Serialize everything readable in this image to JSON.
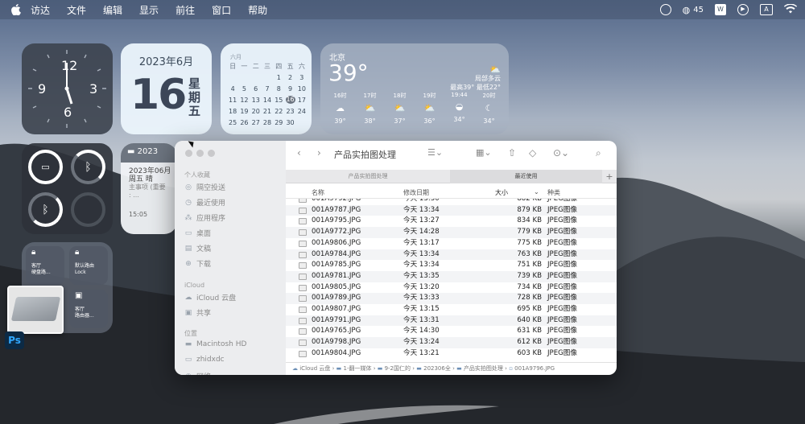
{
  "menubar": {
    "items": [
      "访达",
      "文件",
      "编辑",
      "显示",
      "前往",
      "窗口",
      "帮助"
    ],
    "wechat_count": "45"
  },
  "date_widget": {
    "year_month": "2023年6月",
    "day": "16",
    "weekday": "星期五"
  },
  "calendar_widget": {
    "month_label": "六月",
    "headers": [
      "日",
      "一",
      "二",
      "三",
      "四",
      "五",
      "六"
    ],
    "cells": [
      "",
      "",
      "",
      "",
      "1",
      "2",
      "3",
      "4",
      "5",
      "6",
      "7",
      "8",
      "9",
      "10",
      "11",
      "12",
      "13",
      "14",
      "15",
      "16",
      "17",
      "18",
      "19",
      "20",
      "21",
      "22",
      "23",
      "24",
      "25",
      "26",
      "27",
      "28",
      "29",
      "30",
      ""
    ],
    "today": "16"
  },
  "weather_widget": {
    "city": "北京",
    "temp": "39°",
    "condition": "局部多云",
    "high_low": "最高39° 最低22°",
    "hours": [
      {
        "time": "16时",
        "icon": "cloud-icon",
        "temp": "39°"
      },
      {
        "time": "17时",
        "icon": "sun-cloud-icon",
        "temp": "38°"
      },
      {
        "time": "18时",
        "icon": "sun-cloud-icon",
        "temp": "37°"
      },
      {
        "time": "19时",
        "icon": "sun-cloud-icon",
        "temp": "36°"
      },
      {
        "time": "19:44",
        "icon": "sunset-icon",
        "temp": "34°"
      },
      {
        "time": "20时",
        "icon": "moon-cloud-icon",
        "temp": "34°"
      }
    ]
  },
  "notes_widget": {
    "header": "2023",
    "date": "2023年06月",
    "weekday": "周五 晴",
    "body": "主事项 (重要",
    "dots": ": ...",
    "time": "15:05"
  },
  "shortcuts_widget": {
    "items": [
      {
        "label": "客厅\n硬盘路..."
      },
      {
        "label": "默认路由\nLock"
      },
      {
        "label": ""
      },
      {
        "label": "客厅\n路由器..."
      }
    ]
  },
  "finder": {
    "title": "产品实拍图处理",
    "sidebar": {
      "favorites_header": "个人收藏",
      "favorites": [
        {
          "label": "隔空投送",
          "icon": "airdrop-icon"
        },
        {
          "label": "最近使用",
          "icon": "clock-icon"
        },
        {
          "label": "应用程序",
          "icon": "apps-icon"
        },
        {
          "label": "桌面",
          "icon": "desktop-icon"
        },
        {
          "label": "文稿",
          "icon": "document-icon"
        },
        {
          "label": "下载",
          "icon": "download-icon"
        }
      ],
      "icloud_header": "iCloud",
      "icloud": [
        {
          "label": "iCloud 云盘",
          "icon": "cloud-icon"
        },
        {
          "label": "共享",
          "icon": "shared-folder-icon"
        }
      ],
      "locations_header": "位置",
      "locations": [
        {
          "label": "Macintosh HD",
          "icon": "disk-icon"
        },
        {
          "label": "zhidxdc",
          "icon": "computer-icon"
        },
        {
          "label": "网络",
          "icon": "network-icon"
        }
      ]
    },
    "tabs": [
      "产品实拍图处理",
      "最近使用"
    ],
    "columns": {
      "name": "名称",
      "date": "修改日期",
      "size": "大小",
      "kind": "种类"
    },
    "files": [
      {
        "name": "001A9792.JPG",
        "date": "今天 13:30",
        "size": "882 KB",
        "kind": "JPEG图像"
      },
      {
        "name": "001A9787.JPG",
        "date": "今天 13:34",
        "size": "879 KB",
        "kind": "JPEG图像"
      },
      {
        "name": "001A9795.JPG",
        "date": "今天 13:27",
        "size": "834 KB",
        "kind": "JPEG图像"
      },
      {
        "name": "001A9772.JPG",
        "date": "今天 14:28",
        "size": "779 KB",
        "kind": "JPEG图像"
      },
      {
        "name": "001A9806.JPG",
        "date": "今天 13:17",
        "size": "775 KB",
        "kind": "JPEG图像"
      },
      {
        "name": "001A9784.JPG",
        "date": "今天 13:34",
        "size": "763 KB",
        "kind": "JPEG图像"
      },
      {
        "name": "001A9785.JPG",
        "date": "今天 13:34",
        "size": "751 KB",
        "kind": "JPEG图像"
      },
      {
        "name": "001A9781.JPG",
        "date": "今天 13:35",
        "size": "739 KB",
        "kind": "JPEG图像"
      },
      {
        "name": "001A9805.JPG",
        "date": "今天 13:20",
        "size": "734 KB",
        "kind": "JPEG图像"
      },
      {
        "name": "001A9789.JPG",
        "date": "今天 13:33",
        "size": "728 KB",
        "kind": "JPEG图像"
      },
      {
        "name": "001A9807.JPG",
        "date": "今天 13:15",
        "size": "695 KB",
        "kind": "JPEG图像"
      },
      {
        "name": "001A9791.JPG",
        "date": "今天 13:31",
        "size": "640 KB",
        "kind": "JPEG图像"
      },
      {
        "name": "001A9765.JPG",
        "date": "今天 14:30",
        "size": "631 KB",
        "kind": "JPEG图像"
      },
      {
        "name": "001A9798.JPG",
        "date": "今天 13:24",
        "size": "612 KB",
        "kind": "JPEG图像"
      },
      {
        "name": "001A9804.JPG",
        "date": "今天 13:21",
        "size": "603 KB",
        "kind": "JPEG图像"
      }
    ],
    "path": [
      "iCloud 云盘",
      "1-翻一媒体",
      "9-2国仁的",
      "202306全",
      "产品实拍图处理",
      "001A9796.JPG"
    ]
  }
}
